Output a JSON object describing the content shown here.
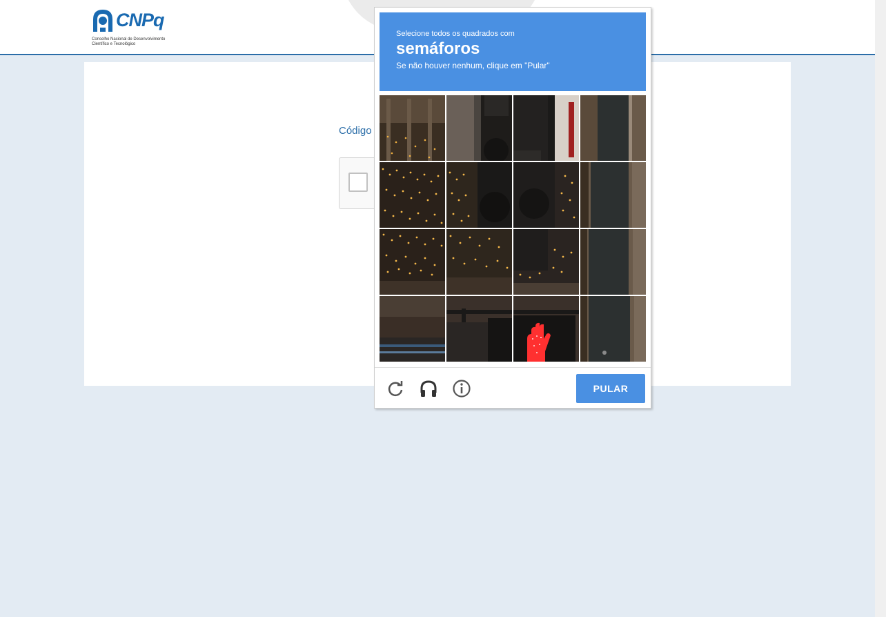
{
  "header": {
    "logo_text": "CNPq",
    "logo_subtitle": "Conselho Nacional de Desenvolvimento\nCientífico e Tecnológico"
  },
  "form": {
    "codigo_label": "Código"
  },
  "captcha": {
    "instruction_line1": "Selecione todos os quadrados com",
    "keyword": "semáforos",
    "instruction_line3": "Se não houver nenhum, clique em \"Pular\"",
    "skip_label": "PULAR",
    "grid_rows": 4,
    "grid_cols": 4,
    "tiles": [
      "tile-1",
      "tile-2",
      "tile-3",
      "tile-4",
      "tile-5",
      "tile-6",
      "tile-7",
      "tile-8",
      "tile-9",
      "tile-10",
      "tile-11",
      "tile-12",
      "tile-13",
      "tile-14",
      "tile-15",
      "tile-16"
    ],
    "icons": [
      "reload-icon",
      "audio-icon",
      "info-icon"
    ]
  },
  "colors": {
    "header_blue": "#4a90e2",
    "brand_blue": "#1a6ab1",
    "page_bg": "#e3ebf3"
  }
}
